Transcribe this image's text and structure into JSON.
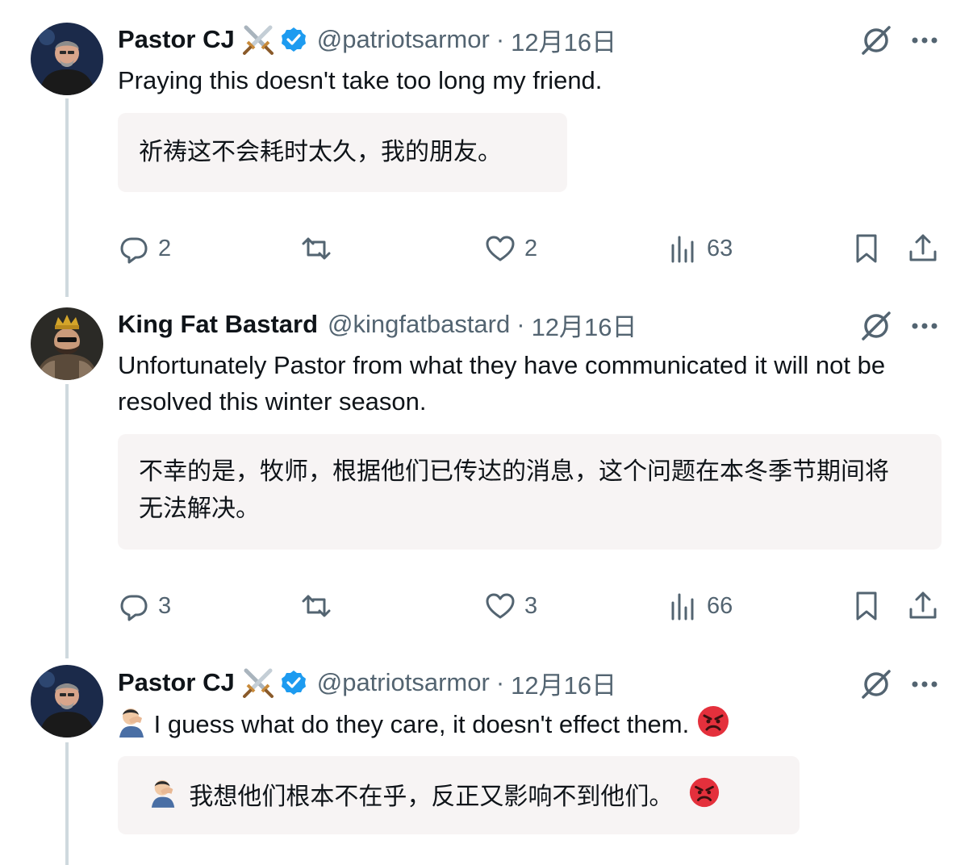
{
  "tweets": [
    {
      "author": "Pastor CJ",
      "handle": "@patriotsarmor",
      "date": "12月16日",
      "text": "Praying this doesn't take too long my friend.",
      "translation": "祈祷这不会耗时太久，我的朋友。",
      "replies": "2",
      "retweets": "",
      "likes": "2",
      "views": "63"
    },
    {
      "author": "King Fat Bastard",
      "handle": "@kingfatbastard",
      "date": "12月16日",
      "text": "Unfortunately Pastor from what they have communicated it will not be resolved this winter season.",
      "translation": "不幸的是，牧师，根据他们已传达的消息，这个问题在本冬季节期间将无法解决。",
      "replies": "3",
      "retweets": "",
      "likes": "3",
      "views": "66"
    },
    {
      "author": "Pastor CJ",
      "handle": "@patriotsarmor",
      "date": "12月16日",
      "text": "I guess what do they care, it doesn't effect them.",
      "translation": "我想他们根本不在乎，反正又影响不到他们。"
    }
  ],
  "separator": "·",
  "colors": {
    "verified": "#1d9bf0",
    "muted": "#536471",
    "translation_bg": "#f7f4f4",
    "thread_line": "#cfd9de"
  },
  "icons": [
    "crossed-swords-emoji",
    "verified-badge-icon",
    "no-response-icon",
    "more-icon",
    "reply-icon",
    "retweet-icon",
    "like-icon",
    "views-icon",
    "bookmark-icon",
    "share-icon",
    "facepalm-emoji",
    "angry-face-emoji"
  ]
}
